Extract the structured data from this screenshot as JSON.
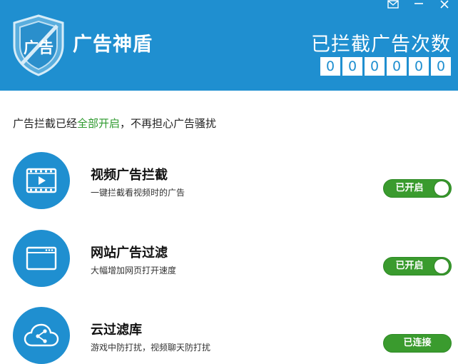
{
  "window": {
    "controls": [
      "mail-icon",
      "minimize-icon",
      "close-icon"
    ]
  },
  "header": {
    "title": "广告神盾",
    "logo_text": "广告",
    "counter_label": "已拦截广告次数",
    "counter_digits": [
      "0",
      "0",
      "0",
      "0",
      "0",
      "0"
    ]
  },
  "status": {
    "prefix": "广告拦截已经",
    "highlight": "全部开启",
    "suffix": "，不再担心广告骚扰"
  },
  "features": [
    {
      "title": "视频广告拦截",
      "desc": "一键拦截看视频时的广告",
      "state": "已开启",
      "icon": "video-icon"
    },
    {
      "title": "网站广告过滤",
      "desc": "大幅增加网页打开速度",
      "state": "已开启",
      "icon": "browser-window-icon"
    },
    {
      "title": "云过滤库",
      "desc": "游戏中防打扰，视频聊天防打扰",
      "state": "已连接",
      "icon": "cloud-share-icon"
    }
  ],
  "colors": {
    "header_bg": "#1f8fd0",
    "toggle_on": "#3a9b2e",
    "highlight_text": "#2e9a2e"
  }
}
